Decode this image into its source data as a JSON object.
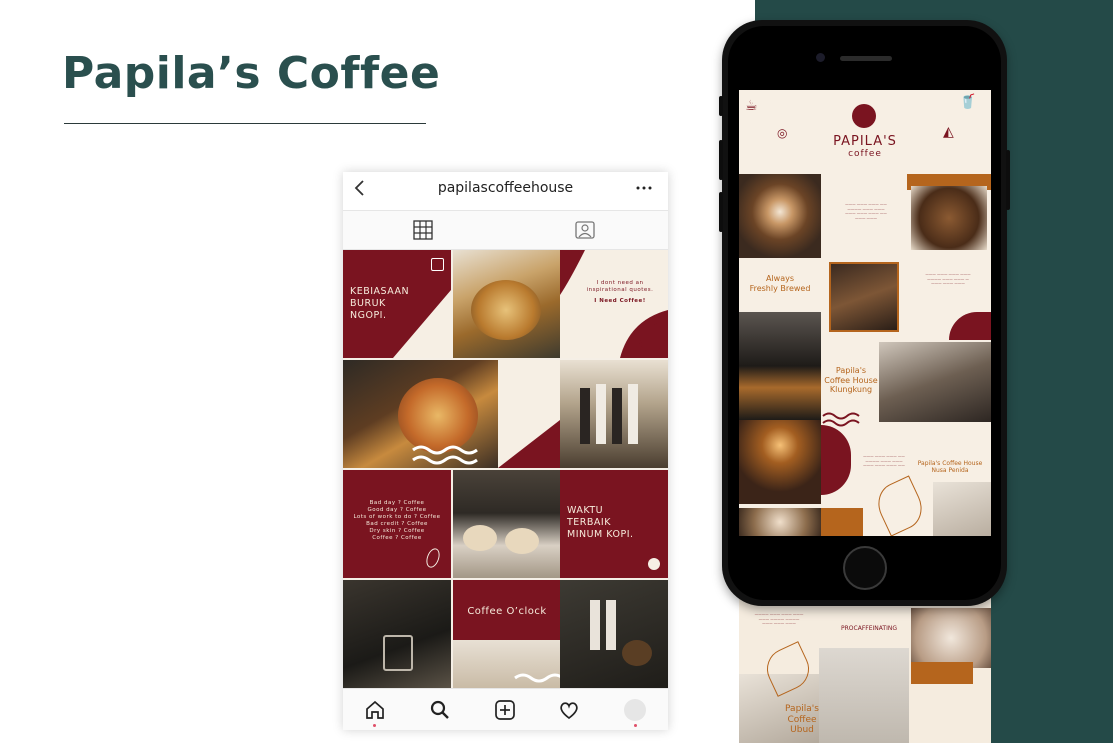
{
  "page": {
    "title": "Papila’s Coffee"
  },
  "instagram": {
    "username": "papilascoffeehouse",
    "back_icon": "chevron-left-icon",
    "more_icon": "more-dots-icon",
    "tabs": [
      {
        "icon": "grid-icon",
        "active": true
      },
      {
        "icon": "tagged-person-icon",
        "active": false
      }
    ],
    "posts": {
      "kebiasaan": "KEBIASAAN\nBURUK\nNGOPI.",
      "quote": "I dont need an\ninspirational quotes.",
      "need_coffee": "I Need Coffee!",
      "coffee_lines": "Bad day ? Coffee\nGood day ? Coffee\nLots of work to do ? Coffee\nBad credit ? Coffee\nDry skin ? Coffee\nCoffee ? Coffee",
      "waktu": "WAKTU\nTERBAIK\nMINUM KOPI.",
      "coffee_oclock": "Coffee O’clock"
    },
    "bottom_nav": [
      {
        "icon": "home-icon"
      },
      {
        "icon": "search-icon"
      },
      {
        "icon": "add-post-icon"
      },
      {
        "icon": "heart-icon"
      },
      {
        "icon": "profile-avatar-icon"
      }
    ]
  },
  "phone_feed": {
    "brand_name": "PAPILA'S",
    "brand_sub": "coffee",
    "always": "Always\nFreshly Brewed",
    "klungkung": "Papila's\nCoffee House\nKlungkung",
    "nusa_penida": "Papila's Coffee House\nNusa Penida",
    "procaffeinating": "PROCAFFEINATING",
    "ubud": "Papila's\nCoffee\nUbud"
  },
  "colors": {
    "maroon": "#7a1420",
    "teal": "#244a48",
    "cream": "#f6efe4",
    "orange": "#b5651d"
  }
}
